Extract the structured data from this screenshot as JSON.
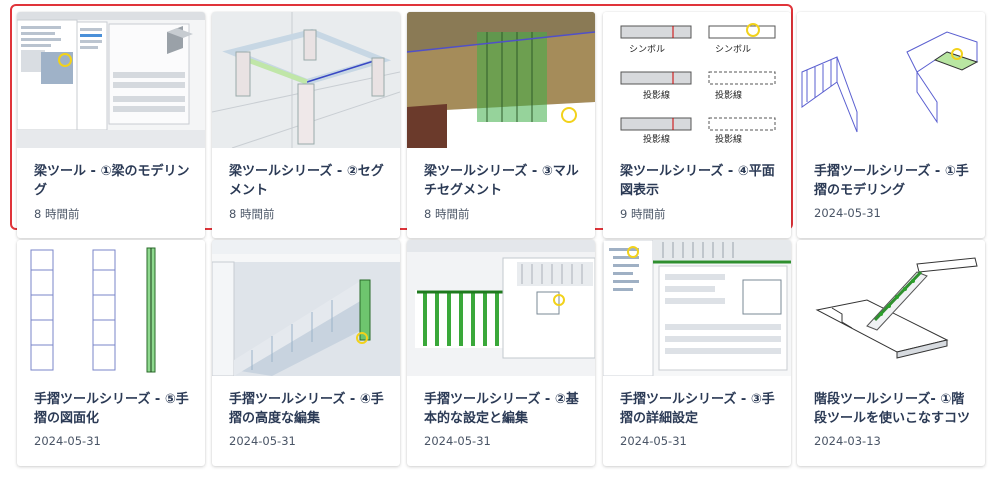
{
  "cards": [
    {
      "title": "梁ツール - ①梁のモデリング",
      "meta": "8 時間前",
      "thumb": "dialog-beam-settings"
    },
    {
      "title": "梁ツールシリーズ - ②セグメント",
      "meta": "8 時間前",
      "thumb": "beam-frame-3d"
    },
    {
      "title": "梁ツールシリーズ - ③マルチセグメント",
      "meta": "8 時間前",
      "thumb": "beam-multisegment-3d"
    },
    {
      "title": "梁ツールシリーズ - ④平面図表示",
      "meta": "9 時間前",
      "thumb": "beam-plan-display",
      "labels": [
        "シンボル",
        "シンボル",
        "投影線",
        "投影線",
        "投影線",
        "投影線"
      ]
    },
    {
      "title": "手摺ツールシリーズ - ①手摺のモデリング",
      "meta": "2024-05-31",
      "thumb": "railing-wireframe"
    },
    {
      "title": "手摺ツールシリーズ - ⑤手摺の図面化",
      "meta": "2024-05-31",
      "thumb": "railing-elevations"
    },
    {
      "title": "手摺ツールシリーズ - ④手摺の高度な編集",
      "meta": "2024-05-31",
      "thumb": "railing-advanced-edit"
    },
    {
      "title": "手摺ツールシリーズ - ②基本的な設定と編集",
      "meta": "2024-05-31",
      "thumb": "railing-basic-settings"
    },
    {
      "title": "手摺ツールシリーズ - ③手摺の詳細設定",
      "meta": "2024-05-31",
      "thumb": "railing-detail-settings"
    },
    {
      "title": "階段ツールシリーズ- ①階段ツールを使いこなすコツ",
      "meta": "2024-03-13",
      "thumb": "stair-tool-3d"
    }
  ],
  "highlight_color": "#e0343a"
}
